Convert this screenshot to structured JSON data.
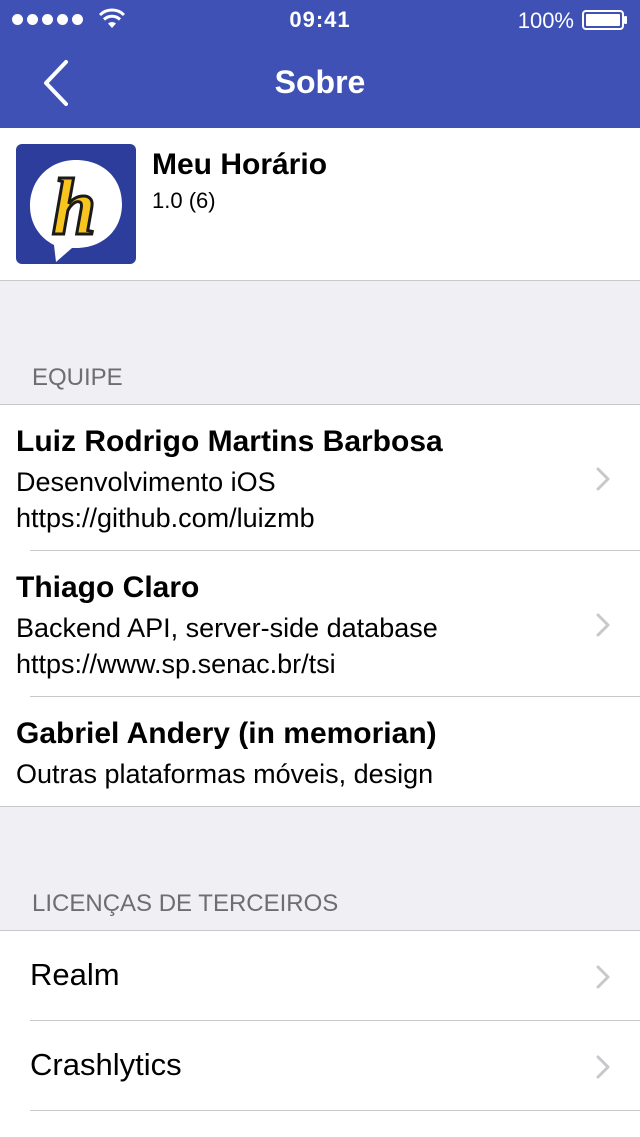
{
  "status_bar": {
    "time": "09:41",
    "battery": "100%"
  },
  "nav": {
    "title": "Sobre"
  },
  "app": {
    "name": "Meu Horário",
    "version": "1.0 (6)"
  },
  "team": {
    "header": "EQUIPE",
    "members": [
      {
        "name": "Luiz Rodrigo Martins Barbosa",
        "role": "Desenvolvimento iOS",
        "link": "https://github.com/luizmb"
      },
      {
        "name": "Thiago Claro",
        "role": "Backend API, server-side database",
        "link": "https://www.sp.senac.br/tsi"
      },
      {
        "name": "Gabriel Andery (in memorian)",
        "role": "Outras plataformas móveis, design"
      }
    ]
  },
  "licenses": {
    "header": "LICENÇAS DE TERCEIROS",
    "items": [
      "Realm",
      "Crashlytics"
    ]
  },
  "colors": {
    "nav_background": "#3f51b5",
    "app_icon_background": "#2d3d9c",
    "app_icon_letter": "#f7c51e"
  },
  "icons": [
    "back-chevron-icon",
    "wifi-icon",
    "battery-icon",
    "app-logo-icon",
    "disclosure-chevron-icon"
  ]
}
